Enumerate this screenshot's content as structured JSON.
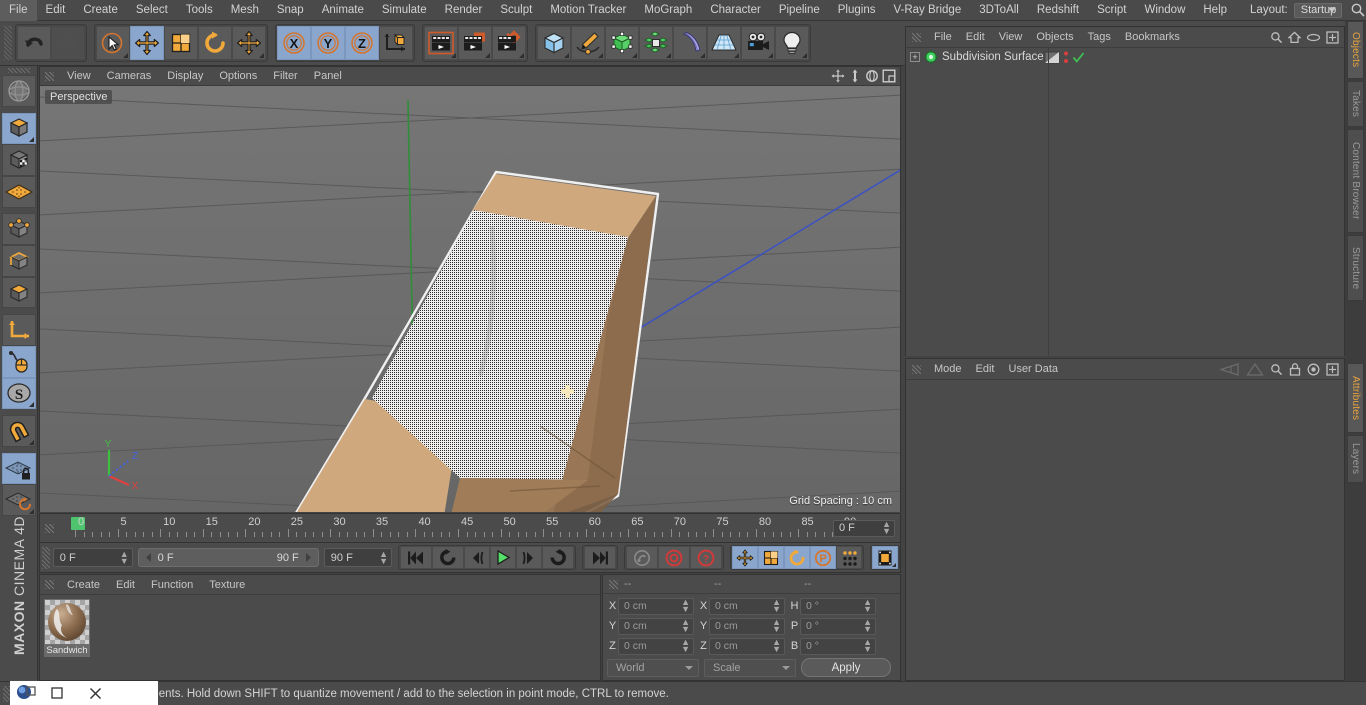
{
  "menubar": {
    "items": [
      "File",
      "Edit",
      "Create",
      "Select",
      "Tools",
      "Mesh",
      "Snap",
      "Animate",
      "Simulate",
      "Render",
      "Sculpt",
      "Motion Tracker",
      "MoGraph",
      "Character",
      "Pipeline",
      "Plugins",
      "V-Ray Bridge",
      "3DToAll",
      "Redshift",
      "Script",
      "Window",
      "Help"
    ],
    "layout_label": "Layout:",
    "layout_value": "Startup",
    "search_icon": "search-icon"
  },
  "toolbar": {
    "groups": [
      {
        "name": "undo-redo",
        "buttons": [
          {
            "icon": "undo-icon",
            "label": "Undo",
            "state": "normal"
          },
          {
            "icon": "redo-icon",
            "label": "Redo",
            "state": "disabled"
          }
        ]
      },
      {
        "name": "transform-tools",
        "buttons": [
          {
            "icon": "select-cursor-icon",
            "label": "Live Selection",
            "state": "normal"
          },
          {
            "icon": "move-icon",
            "label": "Move",
            "state": "active"
          },
          {
            "icon": "scale-icon",
            "label": "Scale",
            "state": "normal"
          },
          {
            "icon": "rotate-icon",
            "label": "Rotate",
            "state": "normal"
          },
          {
            "icon": "move-alt-icon",
            "label": "Move Axis",
            "state": "normal"
          }
        ]
      },
      {
        "name": "axis-locks",
        "buttons": [
          {
            "icon": "axis-x-icon",
            "label": "X Axis",
            "state": "active"
          },
          {
            "icon": "axis-y-icon",
            "label": "Y Axis",
            "state": "active"
          },
          {
            "icon": "axis-z-icon",
            "label": "Z Axis",
            "state": "active"
          },
          {
            "icon": "world-coordinate-icon",
            "label": "World/Object",
            "state": "normal"
          }
        ]
      },
      {
        "name": "render-tools",
        "buttons": [
          {
            "icon": "render-view-icon",
            "label": "Render View",
            "state": "normal"
          },
          {
            "icon": "render-picture-viewer-icon",
            "label": "Render to Picture Viewer",
            "state": "normal"
          },
          {
            "icon": "render-settings-icon",
            "label": "Edit Render Settings",
            "state": "normal"
          }
        ]
      },
      {
        "name": "create-objects",
        "buttons": [
          {
            "icon": "cube-primitive-icon",
            "label": "Add Cube Object",
            "state": "normal"
          },
          {
            "icon": "spline-pen-icon",
            "label": "Add Spline Object",
            "state": "normal"
          },
          {
            "icon": "generator-nurbs-icon",
            "label": "Add Generator Object",
            "state": "normal"
          },
          {
            "icon": "mograph-cloner-icon",
            "label": "Add MoGraph Object",
            "state": "normal"
          },
          {
            "icon": "deformer-bend-icon",
            "label": "Add Deformer Object",
            "state": "normal"
          },
          {
            "icon": "scene-floor-icon",
            "label": "Add Scene Object",
            "state": "normal"
          },
          {
            "icon": "camera-icon",
            "label": "Add Camera Object",
            "state": "normal"
          },
          {
            "icon": "light-bulb-icon",
            "label": "Add Light Object",
            "state": "normal"
          }
        ]
      }
    ]
  },
  "leftbar": {
    "buttons": [
      {
        "icon": "make-editable-icon",
        "label": "Make Editable",
        "state": "normal"
      },
      {
        "icon": "model-mode-icon",
        "label": "Model Mode",
        "state": "active"
      },
      {
        "icon": "texture-mode-icon",
        "label": "Texture Mode",
        "state": "normal"
      },
      {
        "icon": "workplane-mode-icon",
        "label": "Workplane Mode",
        "state": "normal"
      },
      {
        "icon": "points-mode-icon",
        "label": "Points Mode",
        "state": "normal"
      },
      {
        "icon": "edges-mode-icon",
        "label": "Edges Mode",
        "state": "normal"
      },
      {
        "icon": "polygons-mode-icon",
        "label": "Polygons Mode",
        "state": "normal"
      },
      {
        "icon": "axis-modify-icon",
        "label": "Enable Axis Modification",
        "state": "normal"
      },
      {
        "icon": "viewport-solo-icon",
        "label": "Viewport Solo",
        "state": "active"
      },
      {
        "icon": "soft-selection-icon",
        "label": "Enable Soft Selection",
        "state": "active"
      },
      {
        "icon": "snap-magnet-icon",
        "label": "Enable Snapping",
        "state": "normal"
      },
      {
        "icon": "workplane-lock-icon",
        "label": "Lock Workplane",
        "state": "active"
      },
      {
        "icon": "workplane-rotate-icon",
        "label": "Planar Workplane Mode",
        "state": "normal"
      }
    ],
    "brand_bold": "MAXON",
    "brand_rest": " CINEMA 4D"
  },
  "viewport": {
    "menu": [
      "View",
      "Cameras",
      "Display",
      "Options",
      "Filter",
      "Panel"
    ],
    "nav_icons": [
      "pan-camera-icon",
      "dolly-camera-icon",
      "orbit-camera-icon",
      "maximize-viewport-icon"
    ],
    "perspective_label": "Perspective",
    "grid_spacing": "Grid Spacing : 10 cm",
    "axis_labels": {
      "x": "X",
      "y": "Y",
      "z": "Z"
    },
    "axis_colors": {
      "x": "#e04040",
      "y": "#3fbf3f",
      "z": "#4060e0"
    },
    "object_colors": {
      "bread_light": "#cfa87e",
      "bread_mid": "#b9916a",
      "bread_dark": "#8d6c4d",
      "bread_darker": "#7c5f43",
      "selection_outline": "#e8e8e8"
    },
    "background": "#6e6e6e"
  },
  "timeline": {
    "ticks": [
      0,
      5,
      10,
      15,
      20,
      25,
      30,
      35,
      40,
      45,
      50,
      55,
      60,
      65,
      70,
      75,
      80,
      85,
      90
    ],
    "current_frame_field": "0 F",
    "playhead_frame": 0
  },
  "transport": {
    "start_field": "0 F",
    "range_min": "0 F",
    "range_max": "90 F",
    "end_field": "90 F",
    "buttons": [
      {
        "icon": "go-to-start-icon",
        "label": "Go to Start",
        "state": "normal"
      },
      {
        "icon": "previous-key-icon",
        "label": "Go to Previous Key",
        "state": "normal"
      },
      {
        "icon": "step-back-icon",
        "label": "Go to Previous Frame",
        "state": "normal"
      },
      {
        "icon": "play-forward-icon",
        "label": "Play Forward",
        "state": "normal"
      },
      {
        "icon": "step-forward-icon",
        "label": "Go to Next Frame",
        "state": "normal"
      },
      {
        "icon": "next-key-icon",
        "label": "Go to Next Key",
        "state": "normal"
      },
      {
        "icon": "go-to-end-icon",
        "label": "Go to End",
        "state": "normal"
      },
      {
        "icon": "autokey-link-icon",
        "label": "Autokeying",
        "state": "disabled"
      },
      {
        "icon": "record-active-objects-icon",
        "label": "Record Active Objects",
        "state": "normal"
      },
      {
        "icon": "keyframe-selection-icon",
        "label": "Keyframe Selection",
        "state": "normal"
      },
      {
        "icon": "position-key-icon",
        "label": "Record Position",
        "state": "active"
      },
      {
        "icon": "scale-key-icon",
        "label": "Record Scale",
        "state": "active"
      },
      {
        "icon": "rotation-key-icon",
        "label": "Record Rotation",
        "state": "active"
      },
      {
        "icon": "pla-key-icon",
        "label": "Record PLA",
        "state": "active"
      },
      {
        "icon": "point-level-anim-icon",
        "label": "Parameter Animation",
        "state": "normal"
      },
      {
        "icon": "timeline-filmstrip-icon",
        "label": "Animation Mode",
        "state": "active"
      }
    ]
  },
  "materials": {
    "menu": [
      "Create",
      "Edit",
      "Function",
      "Texture"
    ],
    "items": [
      {
        "name": "Sandwich",
        "preview_icon": "material-sphere-icon"
      }
    ]
  },
  "coordinates": {
    "header_dashes": [
      "--",
      "--",
      "--"
    ],
    "rows": [
      {
        "pos_label": "X",
        "pos_value": "0 cm",
        "size_label": "X",
        "size_value": "0 cm",
        "rot_label": "H",
        "rot_value": "0 °"
      },
      {
        "pos_label": "Y",
        "pos_value": "0 cm",
        "size_label": "Y",
        "size_value": "0 cm",
        "rot_label": "P",
        "rot_value": "0 °"
      },
      {
        "pos_label": "Z",
        "pos_value": "0 cm",
        "size_label": "Z",
        "size_value": "0 cm",
        "rot_label": "B",
        "rot_value": "0 °"
      }
    ],
    "system_dropdown": "World",
    "mode_dropdown": "Scale",
    "apply_label": "Apply"
  },
  "objects_panel": {
    "menu": [
      "File",
      "Edit",
      "View",
      "Objects",
      "Tags",
      "Bookmarks"
    ],
    "header_icons": [
      "search-icon",
      "home-icon",
      "ellipse-icon",
      "expand-panel-icon"
    ],
    "tree": [
      {
        "name": "Subdivision Surface",
        "icon": "subdivision-surface-icon",
        "expander": "+",
        "tags": [
          "display-tag-icon",
          "red-dots-tag-icon",
          "green-check-tag-icon"
        ]
      }
    ]
  },
  "attributes_panel": {
    "menu": [
      "Mode",
      "Edit",
      "User Data"
    ],
    "header_icons": [
      "prev-history-icon",
      "next-history-icon",
      "search-icon",
      "lock-icon",
      "target-icon",
      "expand-panel-icon"
    ]
  },
  "vtabs": {
    "top": [
      {
        "label": "Objects",
        "selected": true
      },
      {
        "label": "Takes",
        "selected": false
      },
      {
        "label": "Content Browser",
        "selected": false
      },
      {
        "label": "Structure",
        "selected": false
      }
    ],
    "bottom": [
      {
        "label": "Attributes",
        "selected": true
      },
      {
        "label": "Layers",
        "selected": false
      }
    ]
  },
  "statusbar": {
    "message": "Click and drag to move elements. Hold down SHIFT to quantize movement / add to the selection in point mode, CTRL to remove."
  }
}
